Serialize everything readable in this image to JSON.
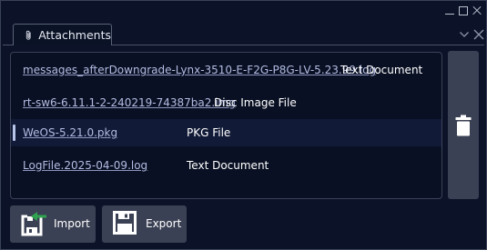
{
  "window": {
    "controls": {
      "minimize": "minimize-icon",
      "maximize": "maximize-icon",
      "close": "close-icon"
    }
  },
  "tab": {
    "label": "Attachments",
    "icon": "paperclip-icon"
  },
  "panel_controls": {
    "collapse": "chevron-down-icon",
    "close": "close-icon"
  },
  "attachments": [
    {
      "name": "messages_afterDowngrade-Lynx-3510-E-F2G-P8G-LV-5.23.99.log",
      "type": "Text Document",
      "selected": false
    },
    {
      "name": "rt-sw6-6.11.1-2-240219-74387ba2.img",
      "type": "Disc Image File",
      "selected": false
    },
    {
      "name": "WeOS-5.21.0.pkg",
      "type": "PKG File",
      "selected": true
    },
    {
      "name": "LogFile.2025-04-09.log",
      "type": "Text Document",
      "selected": false
    }
  ],
  "buttons": {
    "import_label": "Import",
    "export_label": "Export",
    "delete_icon": "trash-icon"
  },
  "colors": {
    "background": "#0c1329",
    "list_background": "#091023",
    "selected_row": "#111a36",
    "link_text": "#b3bbe2",
    "button": "#3b4154",
    "import_arrow": "#2fa44f"
  }
}
